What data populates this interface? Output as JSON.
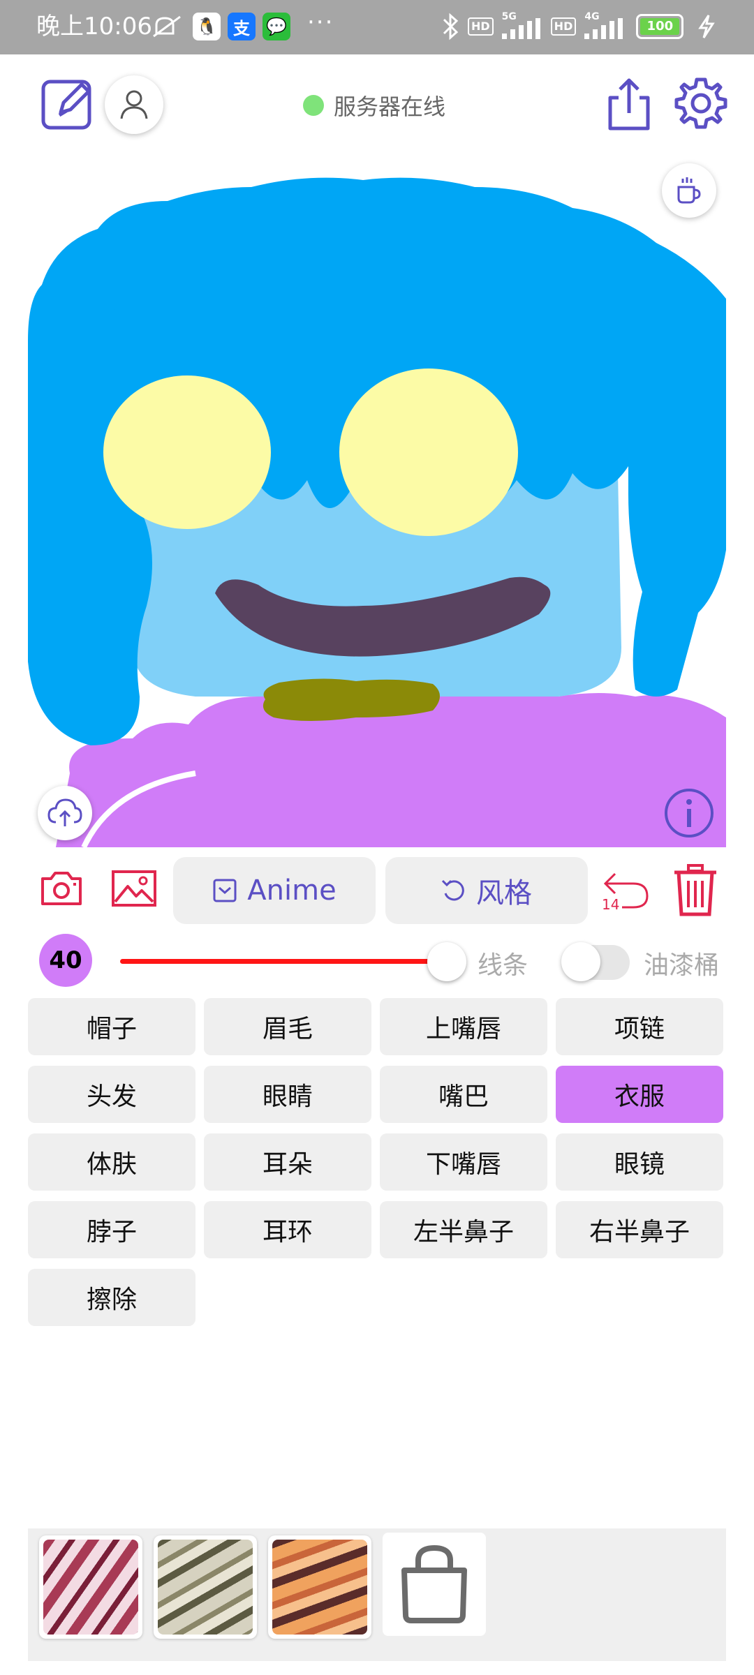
{
  "status_bar": {
    "time": "晚上10:06",
    "apps": [
      {
        "name": "qq-icon",
        "glyph": "🐧"
      },
      {
        "name": "alipay-icon",
        "glyph": "支"
      },
      {
        "name": "wechat-icon",
        "glyph": "💬"
      }
    ],
    "more": "···",
    "net_5g": "5G",
    "net_4g": "4G",
    "hd1": "HD",
    "hd2": "HD",
    "battery": "100"
  },
  "header": {
    "server_status": "服务器在线",
    "status_color": "#7fe37a",
    "accent_color": "#5b4fc4"
  },
  "toolbar": {
    "model_label": "Anime",
    "style_label": "风格",
    "undo_count": "14",
    "danger_color": "#e0264e"
  },
  "brush": {
    "size": "40",
    "lines_label": "线条",
    "bucket_label": "油漆桶",
    "slider_level": 0.85,
    "bucket_enabled": false
  },
  "parts": [
    {
      "label": "帽子",
      "selected": false
    },
    {
      "label": "眉毛",
      "selected": false
    },
    {
      "label": "上嘴唇",
      "selected": false
    },
    {
      "label": "项链",
      "selected": false
    },
    {
      "label": "头发",
      "selected": false
    },
    {
      "label": "眼睛",
      "selected": false
    },
    {
      "label": "嘴巴",
      "selected": false
    },
    {
      "label": "衣服",
      "selected": true
    },
    {
      "label": "体肤",
      "selected": false
    },
    {
      "label": "耳朵",
      "selected": false
    },
    {
      "label": "下嘴唇",
      "selected": false
    },
    {
      "label": "眼镜",
      "selected": false
    },
    {
      "label": "脖子",
      "selected": false
    },
    {
      "label": "耳环",
      "selected": false
    },
    {
      "label": "左半鼻子",
      "selected": false
    },
    {
      "label": "右半鼻子",
      "selected": false
    },
    {
      "label": "擦除",
      "selected": false
    }
  ],
  "canvas_colors": {
    "hair": "#00a6f5",
    "skin": "#80d0f8",
    "eyes": "#fcfba6",
    "mouth": "#58425f",
    "necklace": "#8b8a08",
    "clothes": "#d07cf8"
  },
  "texture_thumbnails": [
    {
      "name": "texture-red-swirl",
      "colors": [
        "#a83a55",
        "#f3dbe3"
      ]
    },
    {
      "name": "texture-olive-stone",
      "colors": [
        "#5c5a42",
        "#d6d2c0"
      ]
    },
    {
      "name": "texture-orange-stripes",
      "colors": [
        "#5a2c2a",
        "#f0a25e"
      ]
    }
  ]
}
